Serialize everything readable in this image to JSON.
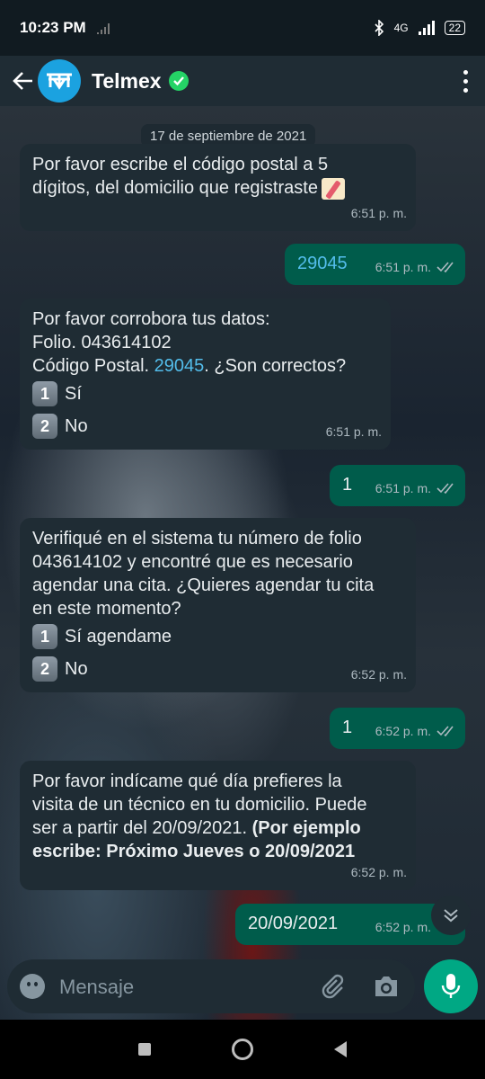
{
  "status_bar": {
    "time": "10:23 PM",
    "network": "4G",
    "battery": "22"
  },
  "header": {
    "contact_name": "Telmex"
  },
  "date_chip": "17 de septiembre de 2021",
  "messages": [
    {
      "dir": "in",
      "lines": [
        "Por favor escribe el código postal a 5",
        "dígitos, del domicilio que registraste"
      ],
      "time": "6:51 p. m."
    },
    {
      "dir": "out",
      "text": "29045",
      "time": "6:51 p. m."
    },
    {
      "dir": "in",
      "line1": "Por favor corrobora tus datos:",
      "line2": "Folio. 043614102",
      "line3_prefix": "Código Postal. ",
      "line3_link": "29045",
      "line3_suffix": ". ¿Son correctos?",
      "options": [
        {
          "num": "1",
          "label": "Sí"
        },
        {
          "num": "2",
          "label": "No"
        }
      ],
      "time": "6:51 p. m."
    },
    {
      "dir": "out",
      "text": "1",
      "time": "6:51 p. m."
    },
    {
      "dir": "in",
      "lines": [
        "Verifiqué en el sistema tu número de folio",
        "043614102 y encontré  que es necesario",
        "agendar una cita. ¿Quieres agendar tu cita",
        "en este momento?"
      ],
      "options": [
        {
          "num": "1",
          "label": "Sí agendame"
        },
        {
          "num": "2",
          "label": "No"
        }
      ],
      "time": "6:52 p. m."
    },
    {
      "dir": "out",
      "text": "1",
      "time": "6:52 p. m."
    },
    {
      "dir": "in",
      "lines": [
        "Por favor indícame qué día prefieres la",
        "visita de un técnico en tu domicilio. Puede",
        "ser a partir del 20/09/2021. "
      ],
      "bold_tail": "(Por ejemplo",
      "bold_line": "escribe: Próximo Jueves o 20/09/2021",
      "time": "6:52 p. m."
    },
    {
      "dir": "out",
      "text": "20/09/2021",
      "time": "6:52 p. m."
    }
  ],
  "composer": {
    "placeholder": "Mensaje"
  },
  "colors": {
    "header_bg": "#1f2c34",
    "incoming_bg": "#1f2c34",
    "outgoing_bg": "#005c4b",
    "accent": "#00a884",
    "link": "#53bdeb"
  }
}
